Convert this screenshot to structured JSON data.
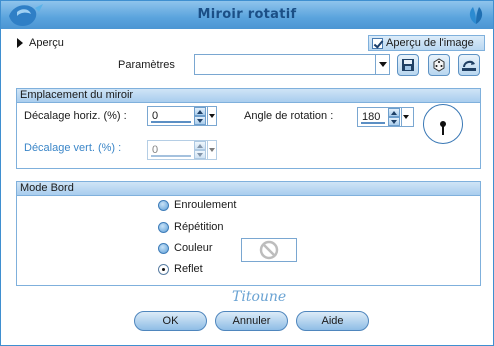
{
  "window": {
    "title": "Miroir rotatif"
  },
  "apercu": {
    "label": "Aperçu",
    "image_preview_label": "Aperçu de l'image",
    "image_preview_checked": true
  },
  "params": {
    "label": "Paramètres",
    "value": ""
  },
  "toolbar_icons": [
    "save-icon",
    "dice-icon",
    "reset-icon"
  ],
  "emplacement": {
    "header": "Emplacement du miroir",
    "horiz_label": "Décalage horiz. (%) :",
    "horiz_value": "0",
    "vert_label": "Décalage vert. (%) :",
    "vert_value": "0",
    "angle_label": "Angle de rotation :",
    "angle_value": "180"
  },
  "mode_bord": {
    "header": "Mode Bord",
    "options": [
      "Enroulement",
      "Répétition",
      "Couleur",
      "Reflet"
    ],
    "selected": "Reflet"
  },
  "signature": "Titoune",
  "buttons": {
    "ok": "OK",
    "cancel": "Annuler",
    "help": "Aide"
  },
  "colors": {
    "accent": "#5aa3dd",
    "border": "#7fb0dc",
    "title_text": "#1b4f86"
  }
}
